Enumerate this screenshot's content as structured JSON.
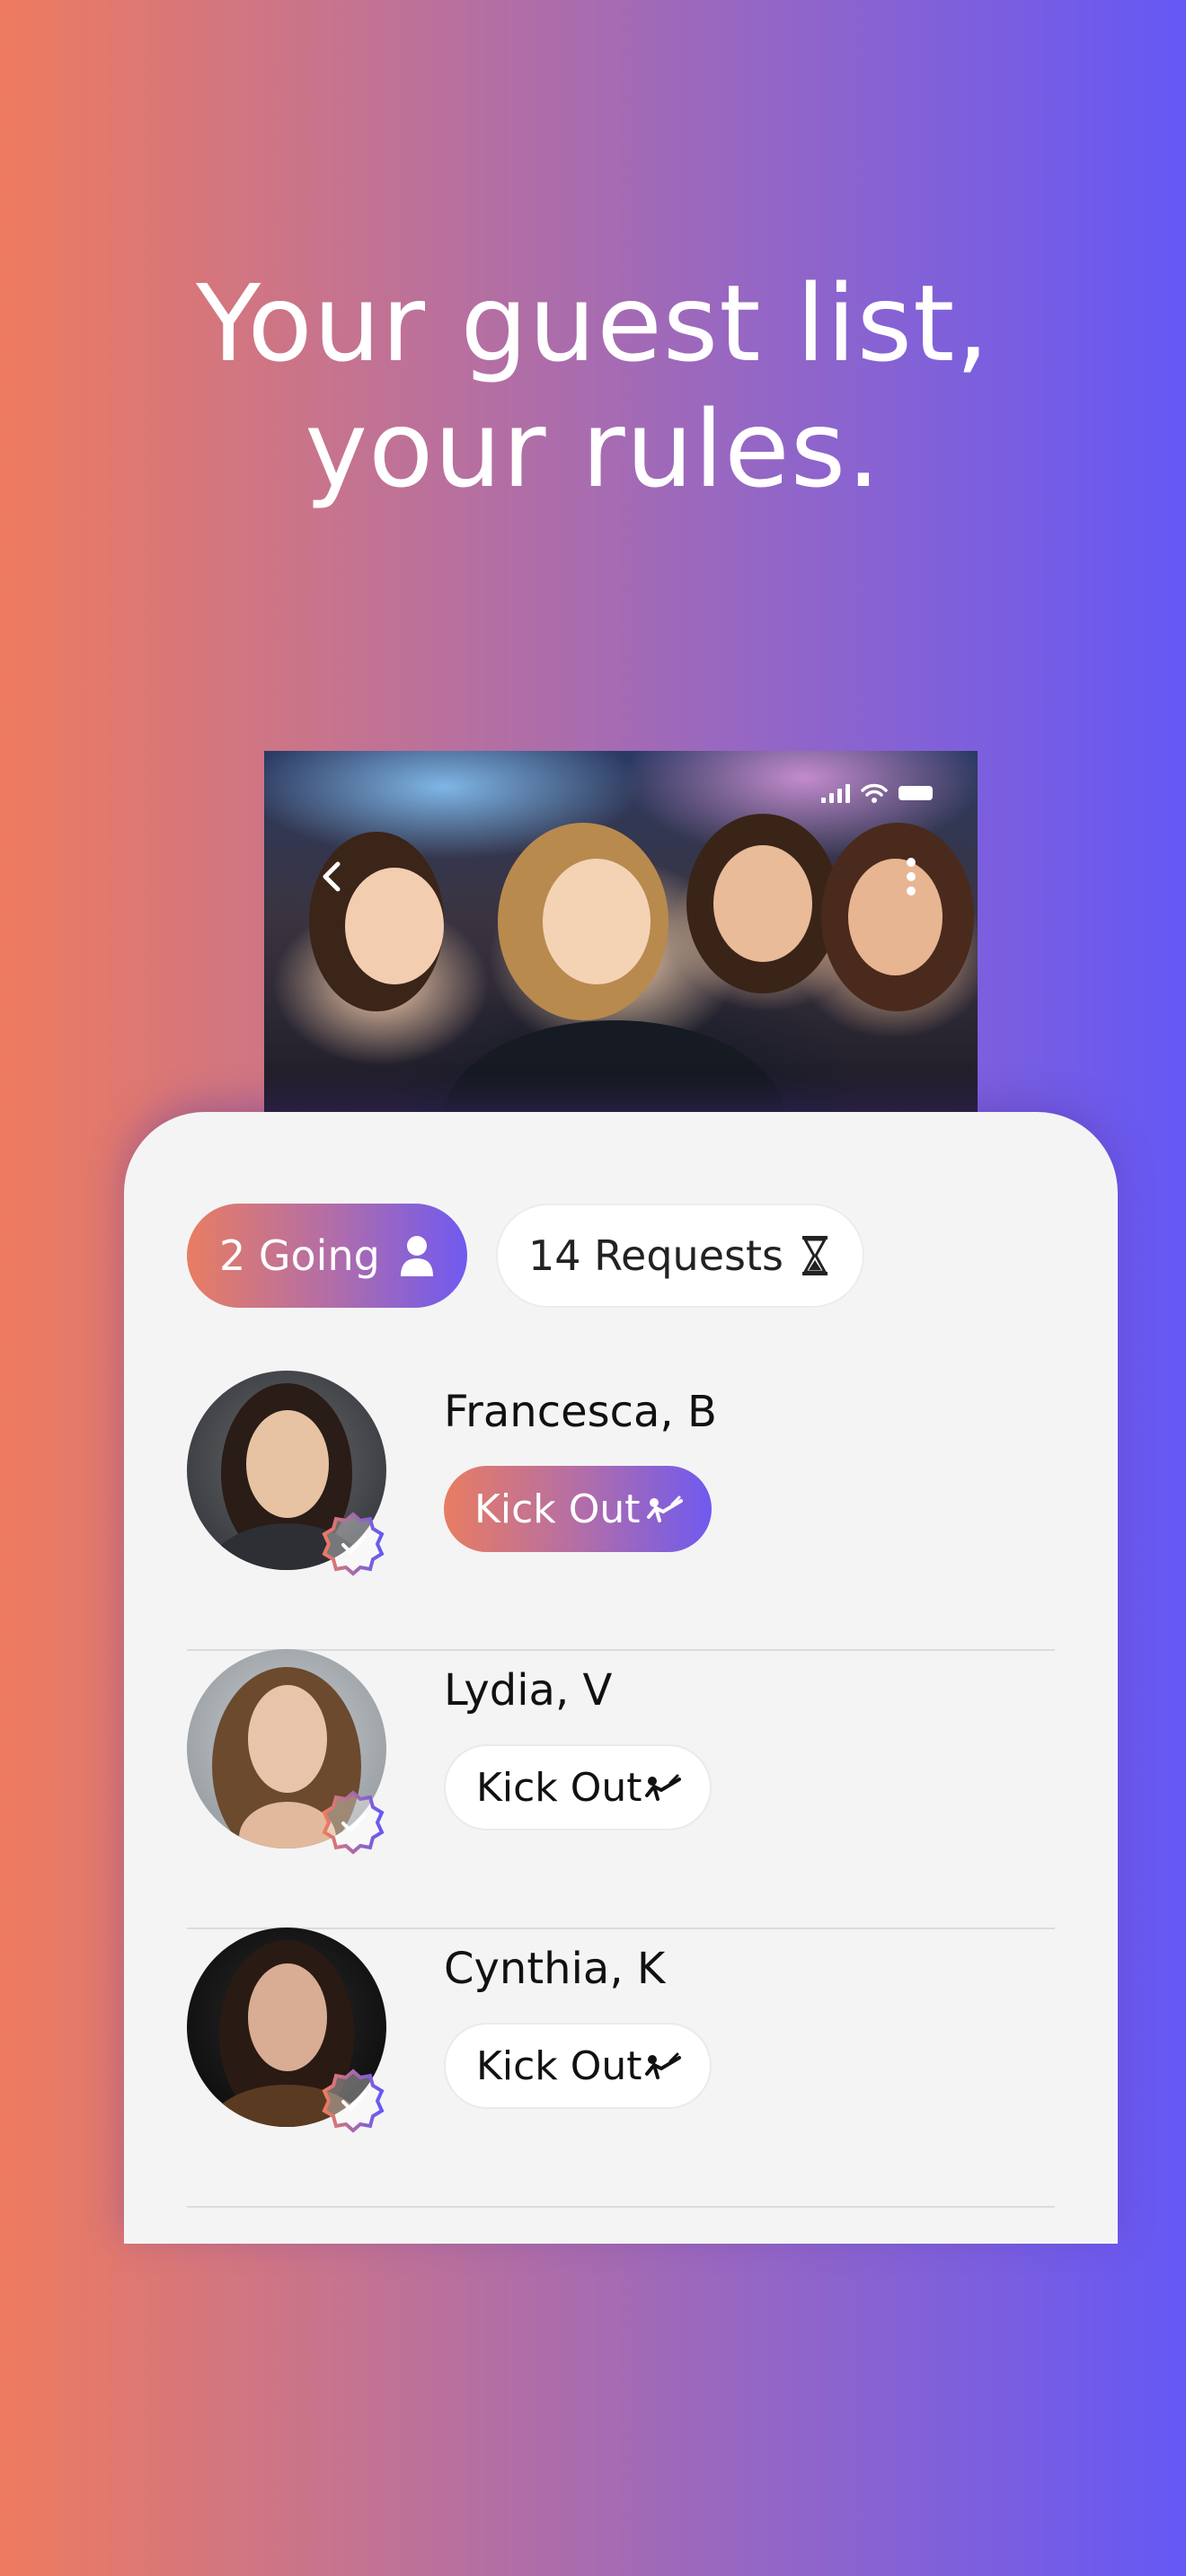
{
  "headline": {
    "line1": "Your guest list,",
    "line2": "your rules."
  },
  "photo": {
    "description_icon_left": "chevron-left-icon",
    "description_icon_right": "more-vertical-icon"
  },
  "status_bar": {
    "icons": [
      "cellular-signal-icon",
      "wifi-icon",
      "battery-icon"
    ]
  },
  "tabs": {
    "going_label": "2 Going",
    "going_icon": "person-icon",
    "requests_label": "14 Requests",
    "requests_icon": "hourglass-icon"
  },
  "guests": [
    {
      "name": "Francesca, B",
      "action": "Kick Out",
      "active": true
    },
    {
      "name": "Lydia, V",
      "action": "Kick Out",
      "active": false
    },
    {
      "name": "Cynthia, K",
      "action": "Kick Out",
      "active": false
    }
  ],
  "colors": {
    "gradient_start": "#EE7B5F",
    "gradient_end": "#6558F5",
    "card_bg": "#F4F4F4"
  }
}
